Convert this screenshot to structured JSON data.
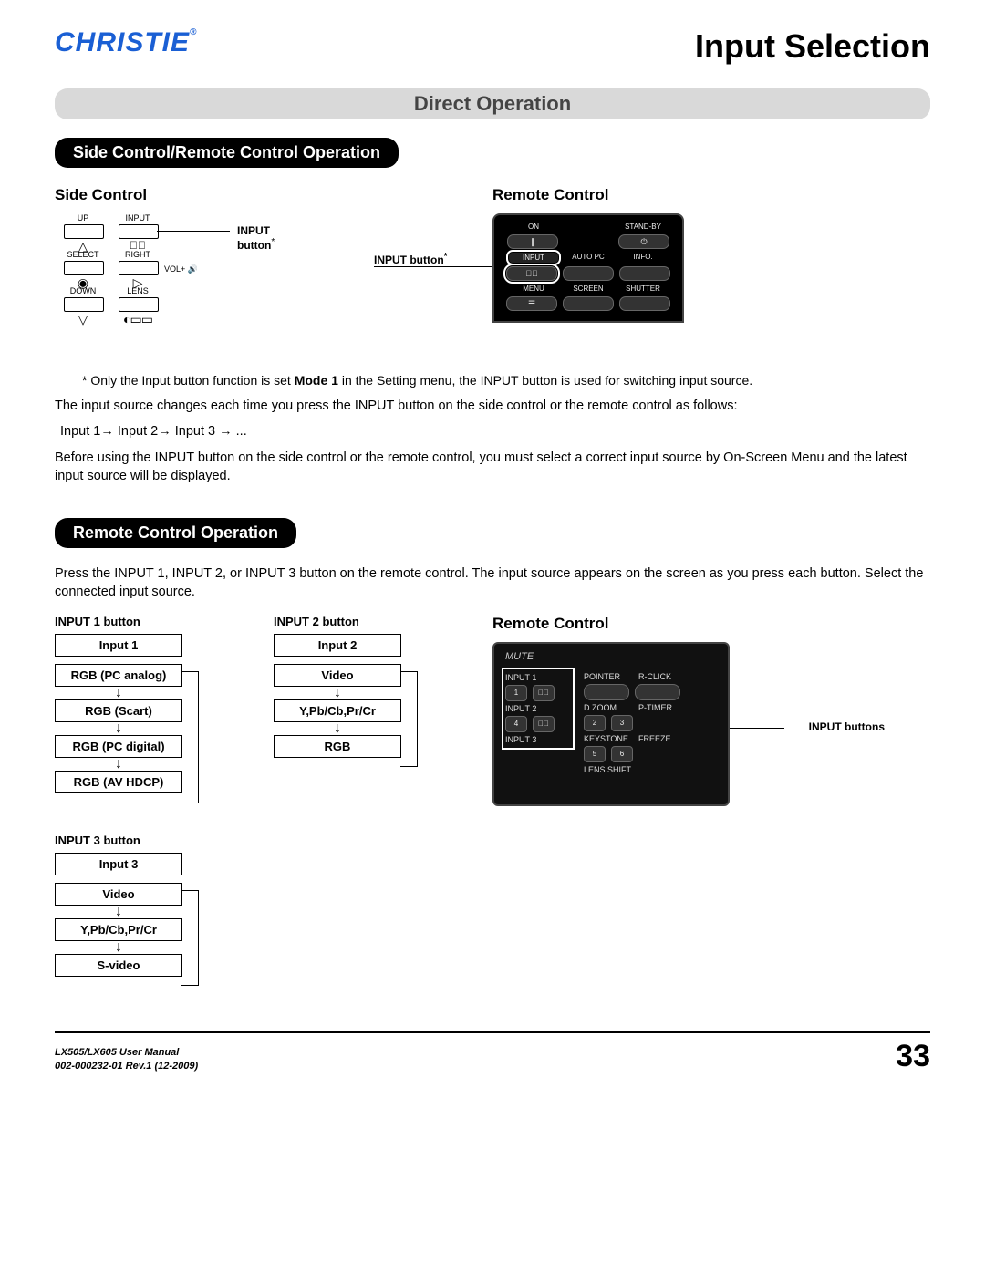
{
  "brand": "CHRISTIE",
  "brand_mark": "®",
  "page_title": "Input Selection",
  "section1_bar": "Direct Operation",
  "pill1": "Side Control/Remote Control Operation",
  "side_control_h": "Side Control",
  "remote_control_h": "Remote Control",
  "sc": {
    "up": "UP",
    "input": "INPUT",
    "select": "SELECT",
    "right": "RIGHT",
    "down": "DOWN",
    "lens": "LENS",
    "vol": "VOL+",
    "callout": "INPUT button",
    "star": "*"
  },
  "rm_top": {
    "on": "ON",
    "standby": "STAND-BY",
    "input": "INPUT",
    "autopc": "AUTO PC",
    "info": "INFO.",
    "menu": "MENU",
    "screen": "SCREEN",
    "shutter": "SHUTTER",
    "callout": "INPUT button",
    "star": "*"
  },
  "footnote": "* Only the Input button function is set Mode 1 in the Setting menu, the INPUT button is used for switching input source.",
  "mode1": "Mode 1",
  "p_change": "The input source changes each time you press the INPUT button on the side control or the remote control as follows:",
  "p_cycle": "Input 1→ Input 2→ Input 3 → ...",
  "p_before": "Before using the INPUT button on the side control or the remote control, you must select a correct input source by On-Screen Menu and the latest input source will be displayed.",
  "pill2": "Remote Control Operation",
  "p_remote": "Press the INPUT 1, INPUT 2, or INPUT 3 button on the remote control. The input source appears on the screen as you press each button. Select the connected input source.",
  "flow1": {
    "head": "INPUT 1 button",
    "b0": "Input 1",
    "b1": "RGB (PC analog)",
    "b2": "RGB (Scart)",
    "b3": "RGB (PC digital)",
    "b4": "RGB (AV HDCP)"
  },
  "flow2": {
    "head": "INPUT 2 button",
    "b0": "Input 2",
    "b1": "Video",
    "b2": "Y,Pb/Cb,Pr/Cr",
    "b3": "RGB"
  },
  "flow3": {
    "head": "INPUT 3 button",
    "b0": "Input 3",
    "b1": "Video",
    "b2": "Y,Pb/Cb,Pr/Cr",
    "b3": "S-video"
  },
  "rm_bot": {
    "mute": "MUTE",
    "input1": "INPUT 1",
    "pointer": "POINTER",
    "rclick": "R-CLICK",
    "input2": "INPUT 2",
    "dzoom": "D.ZOOM",
    "ptimer": "P-TIMER",
    "input3": "INPUT 3",
    "keystone": "KEYSTONE",
    "freeze": "FREEZE",
    "lens": "LENS SHIFT",
    "n1": "1",
    "n2": "2",
    "n3": "3",
    "n4": "4",
    "n5": "5",
    "n6": "6",
    "callout": "INPUT buttons"
  },
  "footer": {
    "manual": "LX505/LX605 User Manual",
    "rev": "002-000232-01 Rev.1 (12-2009)",
    "page": "33"
  }
}
